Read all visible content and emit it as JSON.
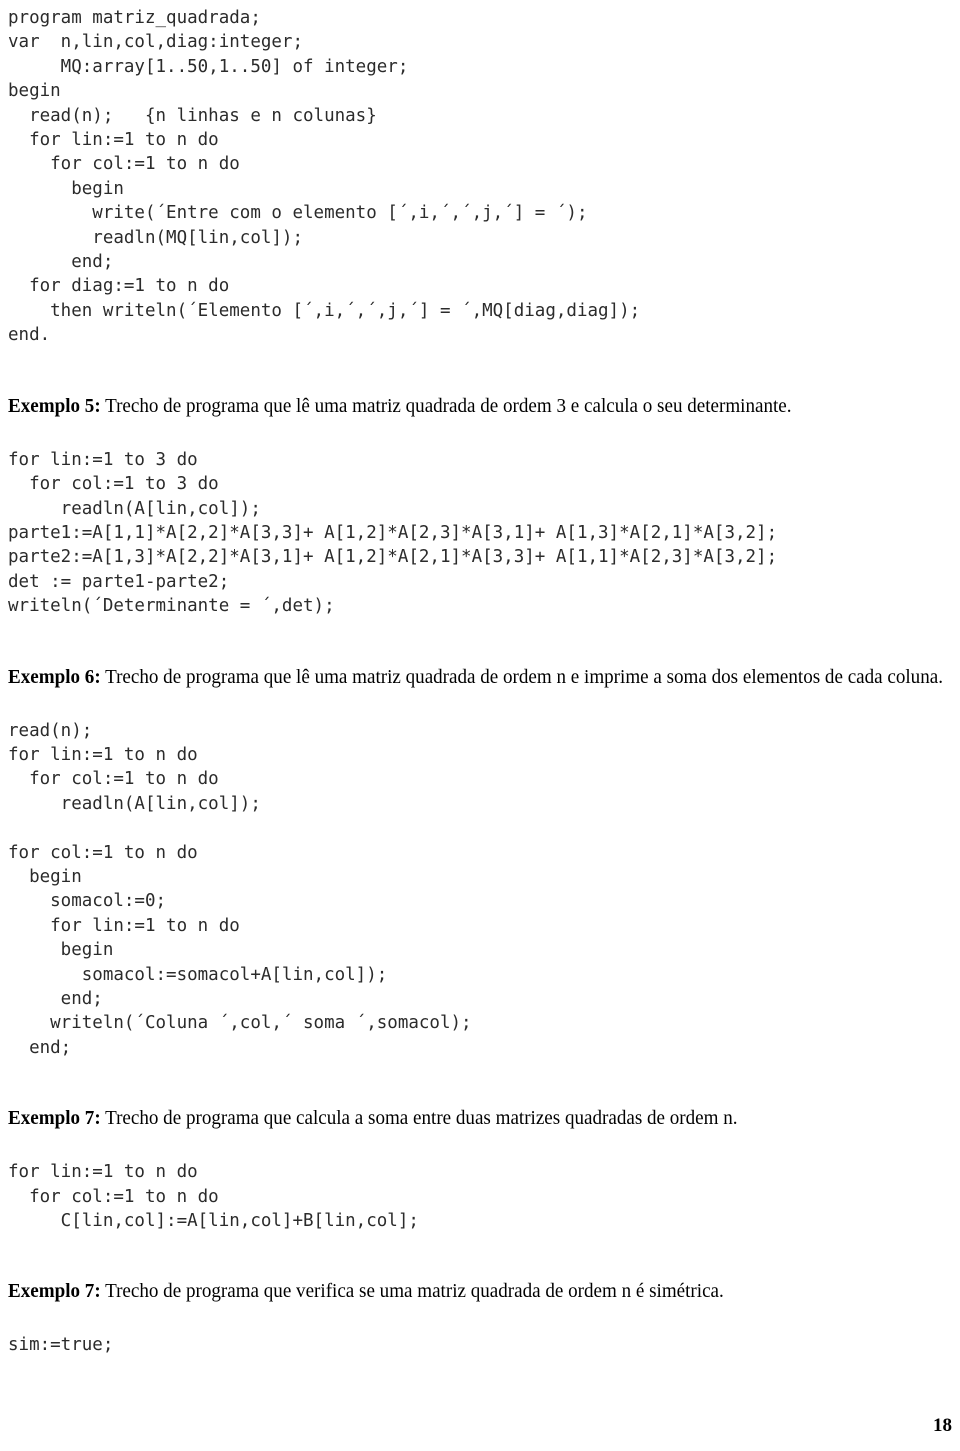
{
  "document": {
    "page_number": "18",
    "language": "Pascal",
    "blocks": [
      {
        "id": "code-block-1",
        "type": "code",
        "lines": [
          "program matriz_quadrada;",
          "var  n,lin,col,diag:integer;",
          "     MQ:array[1..50,1..50] of integer;",
          "begin",
          "  read(n);   {n linhas e n colunas}",
          "  for lin:=1 to n do",
          "    for col:=1 to n do",
          "      begin",
          "        write(´Entre com o elemento [´,i,´,´,j,´] = ´);",
          "        readln(MQ[lin,col]);",
          "      end;",
          "  for diag:=1 to n do",
          "    then writeln(´Elemento [´,i,´,´,j,´] = ´,MQ[diag,diag]);",
          "end."
        ]
      },
      {
        "id": "heading-exemplo-5",
        "type": "heading",
        "label": "Exemplo 5:",
        "text": " Trecho de programa que lê uma matriz quadrada de ordem 3 e calcula o seu determinante."
      },
      {
        "id": "code-block-2",
        "type": "code",
        "lines": [
          "for lin:=1 to 3 do",
          "  for col:=1 to 3 do",
          "     readln(A[lin,col]);",
          "parte1:=A[1,1]*A[2,2]*A[3,3]+ A[1,2]*A[2,3]*A[3,1]+ A[1,3]*A[2,1]*A[3,2];",
          "parte2:=A[1,3]*A[2,2]*A[3,1]+ A[1,2]*A[2,1]*A[3,3]+ A[1,1]*A[2,3]*A[3,2];",
          "det := parte1-parte2;",
          "writeln(´Determinante = ´,det);"
        ]
      },
      {
        "id": "heading-exemplo-6",
        "type": "heading",
        "label": "Exemplo 6:",
        "text": " Trecho de programa que lê uma matriz quadrada de ordem n e imprime a soma dos elementos de cada coluna."
      },
      {
        "id": "code-block-3",
        "type": "code",
        "lines": [
          "read(n);",
          "for lin:=1 to n do",
          "  for col:=1 to n do",
          "     readln(A[lin,col]);",
          "",
          "for col:=1 to n do",
          "  begin",
          "    somacol:=0;",
          "    for lin:=1 to n do",
          "     begin",
          "       somacol:=somacol+A[lin,col]);",
          "     end;",
          "    writeln(´Coluna ´,col,´ soma ´,somacol);",
          "  end;"
        ]
      },
      {
        "id": "heading-exemplo-7a",
        "type": "heading",
        "label": "Exemplo 7:",
        "text": " Trecho de programa que calcula a soma entre duas matrizes quadradas de ordem n."
      },
      {
        "id": "code-block-4",
        "type": "code",
        "lines": [
          "for lin:=1 to n do",
          "  for col:=1 to n do",
          "     C[lin,col]:=A[lin,col]+B[lin,col];"
        ]
      },
      {
        "id": "heading-exemplo-7b",
        "type": "heading",
        "label": "Exemplo 7:",
        "text": " Trecho de programa que verifica se uma matriz quadrada de ordem n é simétrica."
      },
      {
        "id": "code-block-5",
        "type": "code",
        "lines": [
          "sim:=true;"
        ]
      }
    ]
  }
}
